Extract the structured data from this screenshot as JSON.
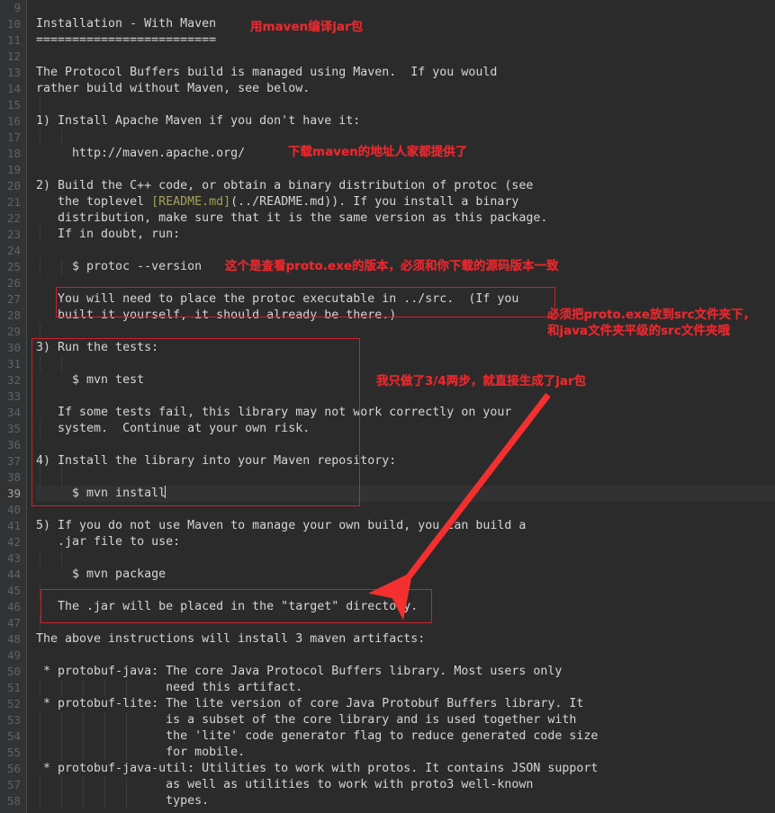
{
  "editor": {
    "theme_bg": "#2b2b2b",
    "gutter_bg": "#313335",
    "text_color": "#d5d5d5",
    "line_number_color": "#606366",
    "current_line": 39,
    "first_line_number": 9,
    "last_line_number": 58,
    "annotation_color": "#e8292f",
    "link_color": "#a5a15b"
  },
  "lines": [
    {
      "n": "9",
      "text": ""
    },
    {
      "n": "10",
      "text": "Installation - With Maven"
    },
    {
      "n": "11",
      "text": "========================="
    },
    {
      "n": "12",
      "text": ""
    },
    {
      "n": "13",
      "text": "The Protocol Buffers build is managed using Maven.  If you would"
    },
    {
      "n": "14",
      "text": "rather build without Maven, see below."
    },
    {
      "n": "15",
      "text": ""
    },
    {
      "n": "16",
      "text": "1) Install Apache Maven if you don't have it:"
    },
    {
      "n": "17",
      "text": ""
    },
    {
      "n": "18",
      "text": "     http://maven.apache.org/"
    },
    {
      "n": "19",
      "text": ""
    },
    {
      "n": "20",
      "text": "2) Build the C++ code, or obtain a binary distribution of protoc (see"
    },
    {
      "n": "21",
      "text": "   the toplevel [README.md](../README.md)). If you install a binary"
    },
    {
      "n": "22",
      "text": "   distribution, make sure that it is the same version as this package."
    },
    {
      "n": "23",
      "text": "   If in doubt, run:"
    },
    {
      "n": "24",
      "text": ""
    },
    {
      "n": "25",
      "text": "     $ protoc --version"
    },
    {
      "n": "26",
      "text": ""
    },
    {
      "n": "27",
      "text": "   You will need to place the protoc executable in ../src.  (If you"
    },
    {
      "n": "28",
      "text": "   built it yourself, it should already be there.)"
    },
    {
      "n": "29",
      "text": ""
    },
    {
      "n": "30",
      "text": "3) Run the tests:"
    },
    {
      "n": "31",
      "text": ""
    },
    {
      "n": "32",
      "text": "     $ mvn test"
    },
    {
      "n": "33",
      "text": ""
    },
    {
      "n": "34",
      "text": "   If some tests fail, this library may not work correctly on your"
    },
    {
      "n": "35",
      "text": "   system.  Continue at your own risk."
    },
    {
      "n": "36",
      "text": ""
    },
    {
      "n": "37",
      "text": "4) Install the library into your Maven repository:"
    },
    {
      "n": "38",
      "text": ""
    },
    {
      "n": "39",
      "text": "     $ mvn install",
      "current": true,
      "caret": true
    },
    {
      "n": "40",
      "text": ""
    },
    {
      "n": "41",
      "text": "5) If you do not use Maven to manage your own build, you can build a"
    },
    {
      "n": "42",
      "text": "   .jar file to use:"
    },
    {
      "n": "43",
      "text": ""
    },
    {
      "n": "44",
      "text": "     $ mvn package"
    },
    {
      "n": "45",
      "text": ""
    },
    {
      "n": "46",
      "text": "   The .jar will be placed in the \"target\" directory."
    },
    {
      "n": "47",
      "text": ""
    },
    {
      "n": "48",
      "text": "The above instructions will install 3 maven artifacts:"
    },
    {
      "n": "49",
      "text": ""
    },
    {
      "n": "50",
      "text": " * protobuf-java: The core Java Protocol Buffers library. Most users only"
    },
    {
      "n": "51",
      "text": "                  need this artifact."
    },
    {
      "n": "52",
      "text": " * protobuf-lite: The lite version of core Java Protobuf Buffers library. It"
    },
    {
      "n": "53",
      "text": "                  is a subset of the core library and is used together with"
    },
    {
      "n": "54",
      "text": "                  the 'lite' code generator flag to reduce generated code size"
    },
    {
      "n": "55",
      "text": "                  for mobile."
    },
    {
      "n": "56",
      "text": " * protobuf-java-util: Utilities to work with protos. It contains JSON support"
    },
    {
      "n": "57",
      "text": "                  as well as utilities to work with proto3 well-known"
    },
    {
      "n": "58",
      "text": "                  types."
    }
  ],
  "annotations": [
    {
      "id": "a1",
      "text": "用maven编译jar包"
    },
    {
      "id": "a2",
      "text": "下载maven的地址人家都提供了"
    },
    {
      "id": "a3",
      "text": "这个是查看proto.exe的版本，必须和你下载的源码版本一致"
    },
    {
      "id": "a4",
      "line1": "必须把proto.exe放到src文件夹下，",
      "line2": "和java文件夹平级的src文件夹哦"
    },
    {
      "id": "a5",
      "text": "我只做了3/4两步，就直接生成了jar包"
    }
  ],
  "highlight_boxes": [
    {
      "id": "box-protoc-src",
      "describes": "You will need to place the protoc executable in ../src."
    },
    {
      "id": "box-steps-3-4",
      "describes": "3) Run the tests / 4) Install the library into your Maven repository"
    },
    {
      "id": "box-target-dir",
      "describes": "The .jar will be placed in the \"target\" directory."
    }
  ]
}
